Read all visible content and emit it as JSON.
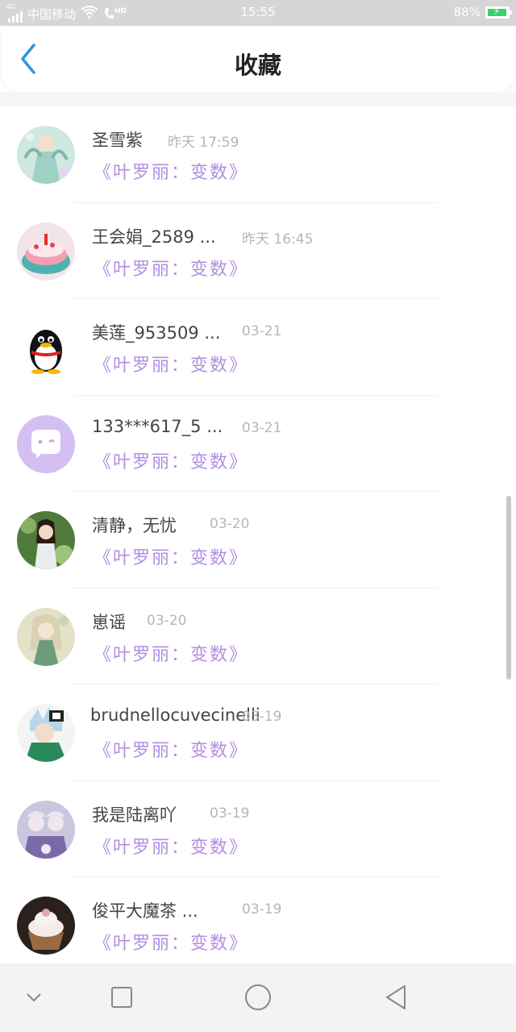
{
  "status_bar": {
    "network_label": "4G",
    "carrier": "中国移动",
    "hd_label": "HD",
    "time": "15:55",
    "battery_text": "88%",
    "battery_level": 0.88,
    "icons": [
      "signal-icon",
      "wifi-icon",
      "call-hd-icon",
      "battery-charging-icon"
    ]
  },
  "header": {
    "title": "收藏",
    "back_icon": "chevron-left-icon",
    "accent_color": "#2b96e5"
  },
  "favorites": [
    {
      "name": "圣雪紫",
      "time": "昨天 17:59",
      "title": "《叶罗丽：变数》"
    },
    {
      "name": "王会娟_2589 ...",
      "time": "昨天 16:45",
      "title": "《叶罗丽：变数》"
    },
    {
      "name": "美莲_953509 ...",
      "time": "03-21",
      "title": "《叶罗丽：变数》"
    },
    {
      "name": "133***617_5 ...",
      "time": "03-21",
      "title": "《叶罗丽：变数》"
    },
    {
      "name": "清静，无忧",
      "time": "03-20",
      "title": "《叶罗丽：变数》"
    },
    {
      "name": "崽谣",
      "time": "03-20",
      "title": "《叶罗丽：变数》"
    },
    {
      "name": "brudnellocuvecinelli",
      "time": "03-19",
      "title": "《叶罗丽：变数》"
    },
    {
      "name": "我是陆离吖",
      "time": "03-19",
      "title": "《叶罗丽：变数》"
    },
    {
      "name": "俊平大魔茶 ...",
      "time": "03-19",
      "title": "《叶罗丽：变数》"
    }
  ],
  "colors": {
    "title_purple": "#b18ee0",
    "time_gray": "#b6b6b6"
  },
  "nav_bar": {
    "icons": [
      "chevron-down-icon",
      "square-recents-icon",
      "circle-home-icon",
      "triangle-back-icon"
    ]
  }
}
